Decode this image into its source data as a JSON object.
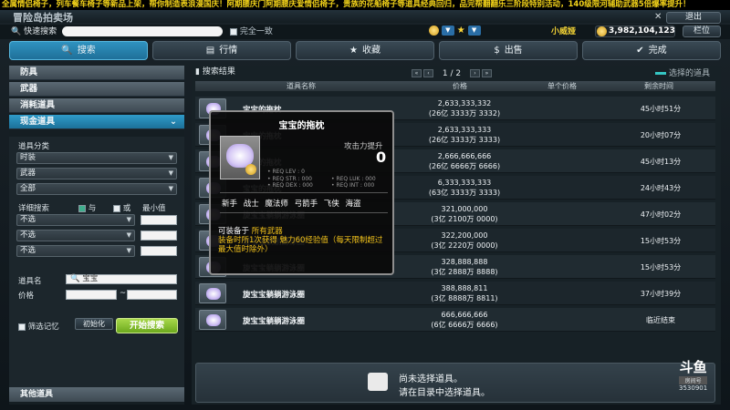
{
  "marquee": "全属情侣椅子，列车餐车椅子等新品上架，帮你制造表浪漫国庆！阿期腰庆门阿期腰庆爱情侣椅子，贵族的花船椅子等道具经典回归，品完帮翻翻乐三阶段特别活动，140级限河辅助武器5倍爆率提升！",
  "window": {
    "title": "冒险岛拍卖场",
    "exit_label": "退出",
    "exit_icon": "close-icon"
  },
  "top": {
    "quick_search_label": "快速搜索",
    "exact_label": "完全一致",
    "username": "小威娅",
    "meso": "3,982,104,123",
    "slot_label": "栏位"
  },
  "tabs": [
    {
      "label": "搜索",
      "icon": "search-icon",
      "active": true
    },
    {
      "label": "行情",
      "icon": "chart-icon",
      "active": false
    },
    {
      "label": "收藏",
      "icon": "star-icon",
      "active": false
    },
    {
      "label": "出售",
      "icon": "coin-icon",
      "active": false
    },
    {
      "label": "完成",
      "icon": "check-icon",
      "active": false
    }
  ],
  "sidebar": {
    "categories": [
      "防具",
      "武器",
      "消耗道具",
      "现金道具"
    ],
    "item_class_label": "道具分类",
    "item_class": [
      "时装",
      "武器",
      "全部"
    ],
    "detail_label": "详细搜索",
    "and_label": "与",
    "or_label": "或",
    "min_label": "最小值",
    "detail_selects": [
      "不选",
      "不选",
      "不选"
    ],
    "item_name_label": "道具名",
    "item_name_value": "宝宝",
    "price_label": "价格",
    "filter_memory_label": "筛选记忆",
    "init_label": "初始化",
    "search_label": "开始搜索",
    "other_label": "其他道具"
  },
  "results": {
    "title": "搜索结果",
    "page": "1 / 2",
    "legend": "选择的道具",
    "columns": [
      "道具名称",
      "价格",
      "单个价格",
      "剩余时间"
    ],
    "rows": [
      {
        "name": "宝宝的拖枕",
        "price": "2,633,333,332",
        "price_sub": "(26亿 3333万 3332)",
        "time": "45小时51分"
      },
      {
        "name": "宝宝的拖枕",
        "price": "2,633,333,333",
        "price_sub": "(26亿 3333万 3333)",
        "time": "20小时07分"
      },
      {
        "name": "宝宝的拖枕",
        "price": "2,666,666,666",
        "price_sub": "(26亿 6666万 6666)",
        "time": "45小时13分"
      },
      {
        "name": "宝宝的拖枕",
        "price": "6,333,333,333",
        "price_sub": "(63亿 3333万 3333)",
        "time": "24小时43分"
      },
      {
        "name": "旋宝宝躺躺游泳圈",
        "price": "321,000,000",
        "price_sub": "(3亿 2100万 0000)",
        "time": "47小时02分"
      },
      {
        "name": "旋宝宝躺躺游泳圈",
        "price": "322,200,000",
        "price_sub": "(3亿 2220万 0000)",
        "time": "15小时53分"
      },
      {
        "name": "旋宝宝躺躺游泳圈",
        "price": "328,888,888",
        "price_sub": "(3亿 2888万 8888)",
        "time": "15小时53分"
      },
      {
        "name": "旋宝宝躺躺游泳圈",
        "price": "388,888,811",
        "price_sub": "(3亿 8888万 8811)",
        "time": "37小时39分"
      },
      {
        "name": "旋宝宝躺躺游泳圈",
        "price": "666,666,666",
        "price_sub": "(6亿 6666万 6666)",
        "time": "临近结束"
      }
    ],
    "empty_line1": "尚未选择道具。",
    "empty_line2": "请在目录中选择道具。"
  },
  "tooltip": {
    "title": "宝宝的拖枕",
    "atk_label": "攻击力提升",
    "atk_value": "0",
    "req": [
      "• REQ LEV : 0",
      "• REQ STR : 000",
      "• REQ LUK : 000",
      "• REQ DEX : 000",
      "• REQ INT : 000"
    ],
    "jobs": "新手 战士 魔法师 弓箭手 飞侠 海盗",
    "avail_prefix": "可装备于",
    "avail_value": "所有武器",
    "desc": "装备时所1次获得 魅力60经验值（每天限制超过最大值时除外）"
  },
  "watermark": {
    "brand": "斗鱼",
    "room_label": "房间号",
    "room_id": "3530901"
  }
}
